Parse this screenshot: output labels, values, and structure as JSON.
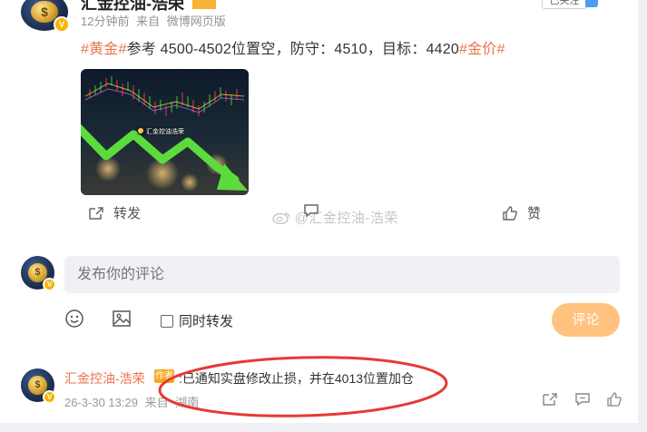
{
  "post": {
    "author": "汇金控油-浩荣",
    "time": "12分钟前",
    "source_prefix": "来自",
    "source": "微博网页版",
    "follow_label": "已关注",
    "text_topic1": "#黄金#",
    "text_body": "参考 4500-4502位置空，防守：4510，目标：4420",
    "text_topic2": "#金价#",
    "image_caption": "汇金控油浩荣",
    "actions": {
      "repost": "转发",
      "like": "赞"
    },
    "watermark": "@汇金控油-浩荣"
  },
  "composer": {
    "placeholder": "发布你的评论",
    "also_repost_label": "同时转发",
    "submit_label": "评论",
    "submit_color": "#ffc27f"
  },
  "comment": {
    "author": "汇金控油-浩荣",
    "badge": "作者",
    "text": ":已通知实盘修改止损，并在4013位置加仓",
    "time": "26-3-30 13:29",
    "source_prefix": "来自",
    "source": "湖南"
  },
  "colors": {
    "accent": "#eb7350",
    "annotation": "#e53935"
  },
  "icons": [
    "emoji-icon",
    "image-icon",
    "share-icon",
    "comment-icon",
    "like-icon",
    "verified-icon"
  ]
}
